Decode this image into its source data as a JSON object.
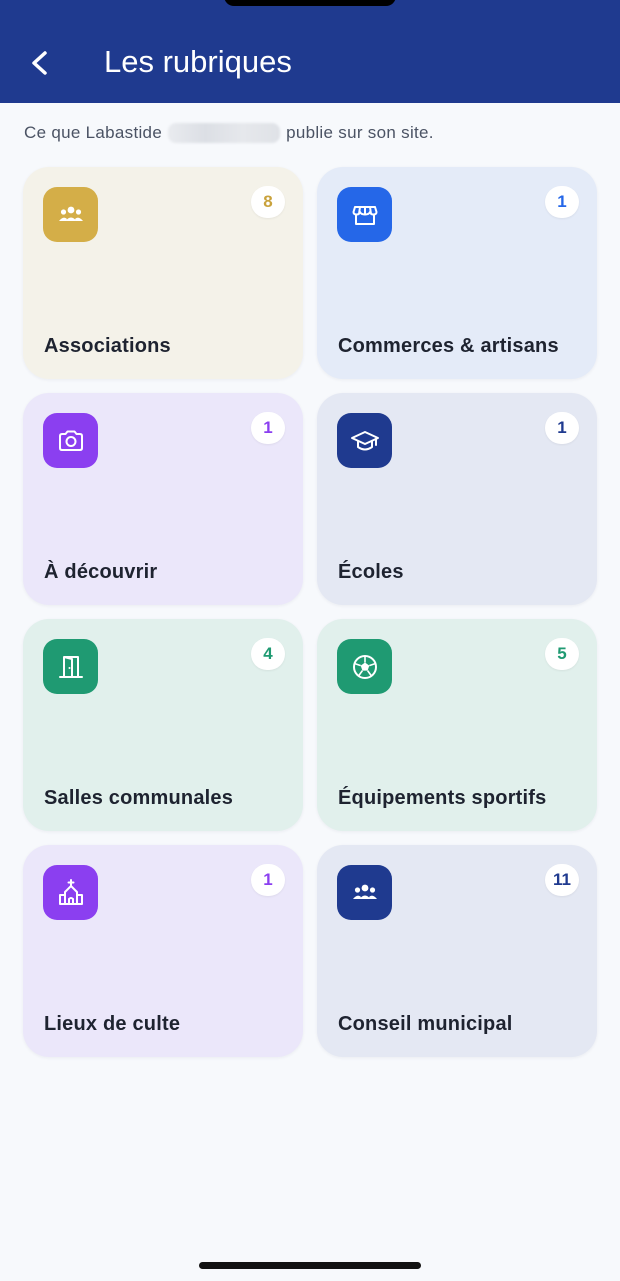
{
  "header": {
    "title": "Les rubriques",
    "back_icon": "chevron-left-icon"
  },
  "intro": {
    "prefix": "Ce que Labastide",
    "suffix": "publie sur son site."
  },
  "colors": {
    "header_bg": "#1f3a8f",
    "gold": "#d4ae48",
    "blue": "#2567e8",
    "purple": "#8b3ff0",
    "navy": "#1f3a8f",
    "green": "#1f9a72"
  },
  "categories": [
    {
      "label": "Associations",
      "count": "8",
      "icon": "users-group-icon",
      "icon_bg": "#d4ae48",
      "card_bg": "#f4f2e9",
      "count_color": "#c9a23c"
    },
    {
      "label": "Commerces & artisans",
      "count": "1",
      "icon": "storefront-icon",
      "icon_bg": "#2567e8",
      "card_bg": "#e4ebf8",
      "count_color": "#2567e8"
    },
    {
      "label": "À découvrir",
      "count": "1",
      "icon": "camera-icon",
      "icon_bg": "#8b3ff0",
      "card_bg": "#ebe7fa",
      "count_color": "#8b3ff0"
    },
    {
      "label": "Écoles",
      "count": "1",
      "icon": "graduation-cap-icon",
      "icon_bg": "#1f3a8f",
      "card_bg": "#e4e8f3",
      "count_color": "#1f3a8f"
    },
    {
      "label": "Salles communales",
      "count": "4",
      "icon": "door-icon",
      "icon_bg": "#1f9a72",
      "card_bg": "#e1f0ec",
      "count_color": "#1f9a72"
    },
    {
      "label": "Équipements sportifs",
      "count": "5",
      "icon": "soccer-ball-icon",
      "icon_bg": "#1f9a72",
      "card_bg": "#e1f0ec",
      "count_color": "#1f9a72"
    },
    {
      "label": "Lieux de culte",
      "count": "1",
      "icon": "church-icon",
      "icon_bg": "#8b3ff0",
      "card_bg": "#ebe7fa",
      "count_color": "#8b3ff0"
    },
    {
      "label": "Conseil municipal",
      "count": "11",
      "icon": "council-group-icon",
      "icon_bg": "#1f3a8f",
      "card_bg": "#e4e8f3",
      "count_color": "#1f3a8f"
    }
  ]
}
